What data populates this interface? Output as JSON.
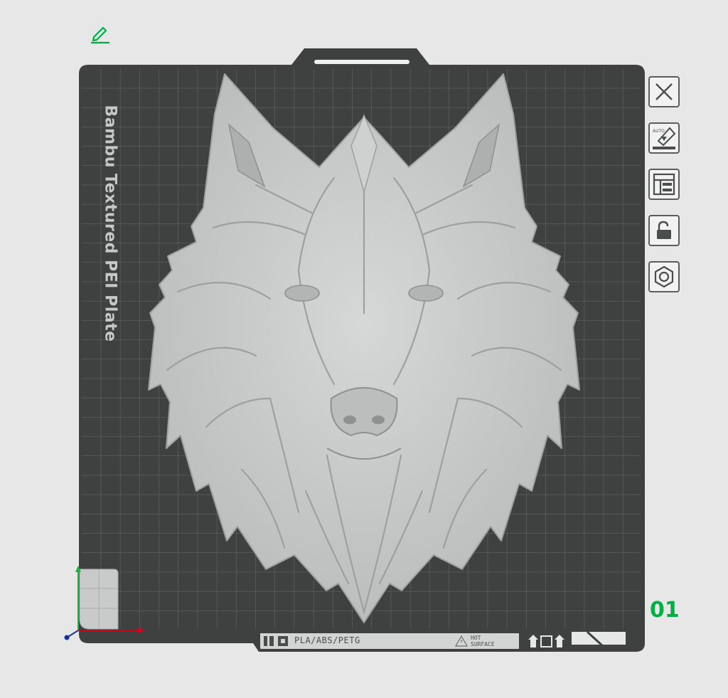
{
  "plate": {
    "label": "Bambu Textured PEI Plate",
    "number": "01",
    "strip_text": "PLA/ABS/PETG",
    "hot_line1": "HOT",
    "hot_line2": "SURFACE"
  },
  "toolbar": [
    {
      "name": "close-plate-button",
      "icon": "close-icon"
    },
    {
      "name": "auto-orient-button",
      "icon": "auto-orient-icon",
      "badge": "AUTO"
    },
    {
      "name": "arrange-button",
      "icon": "arrange-icon"
    },
    {
      "name": "lock-button",
      "icon": "unlock-icon"
    },
    {
      "name": "plate-settings-button",
      "icon": "hex-settings-icon"
    }
  ],
  "colors": {
    "background": "#e6e7e6",
    "plate": "#3e4140",
    "grid": "#6b6e6d",
    "model": "#c9cbca",
    "accent": "#00ae42",
    "axis_x": "#d0021b",
    "axis_y": "#19b23b",
    "axis_z": "#1a2ea8"
  }
}
